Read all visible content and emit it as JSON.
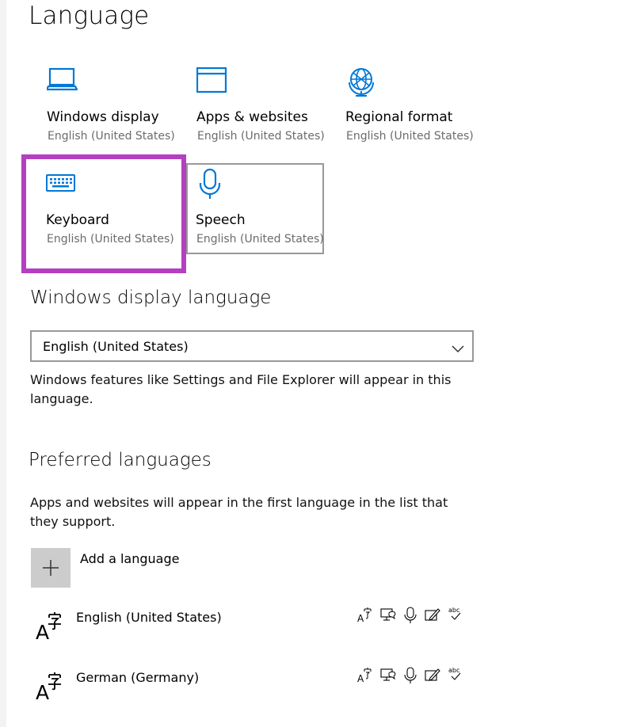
{
  "page": {
    "title": "Language"
  },
  "tiles": [
    {
      "label": "Windows display",
      "sub": "English (United States)",
      "icon": "laptop-icon"
    },
    {
      "label": "Apps & websites",
      "sub": "English (United States)",
      "icon": "browser-window-icon"
    },
    {
      "label": "Regional format",
      "sub": "English (United States)",
      "icon": "globe-icon"
    },
    {
      "label": "Keyboard",
      "sub": "English (United States)",
      "icon": "keyboard-icon"
    },
    {
      "label": "Speech",
      "sub": "English (United States)",
      "icon": "microphone-icon"
    }
  ],
  "display_language": {
    "heading": "Windows display language",
    "selected": "English (United States)",
    "description": "Windows features like Settings and File Explorer will appear in this language."
  },
  "preferred": {
    "heading": "Preferred languages",
    "description": "Apps and websites will appear in the first language in the list that they support.",
    "add_label": "Add a language",
    "languages": [
      {
        "name": "English (United States)"
      },
      {
        "name": "German (Germany)"
      }
    ],
    "feature_icons": [
      "language-pack-icon",
      "text-to-speech-icon",
      "speech-recognition-icon",
      "handwriting-icon",
      "spell-check-icon"
    ]
  },
  "colors": {
    "accent": "#0078d7",
    "highlight": "#b43fc0"
  }
}
